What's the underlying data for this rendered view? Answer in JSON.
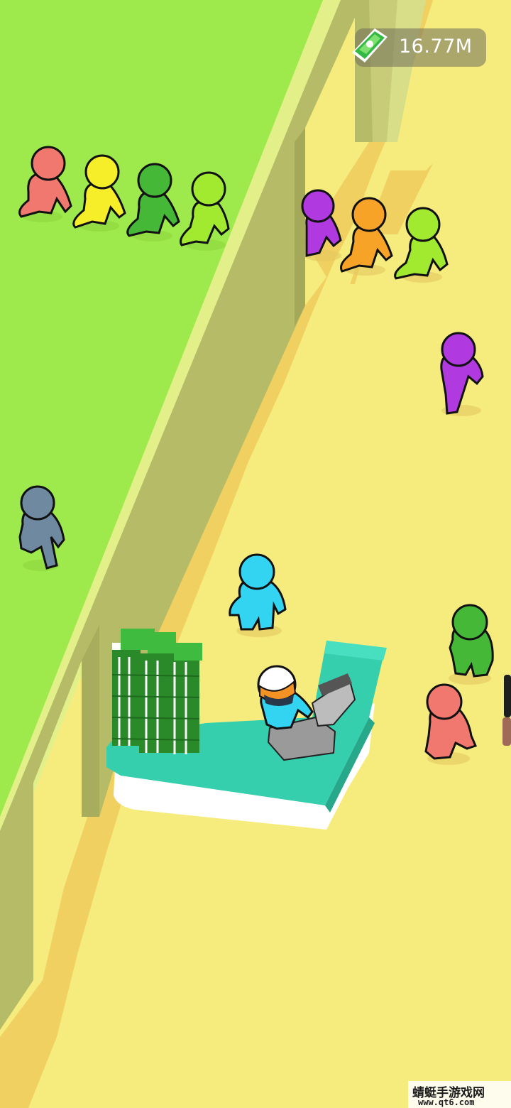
{
  "hud": {
    "money_value": "16.77M",
    "money_icon": "cash-stack-icon"
  },
  "colors": {
    "grass": "#9eea4d",
    "wall": "#b6bb67",
    "floor": "#f6ec7e",
    "path": "#f0d060",
    "counter": "#35cfae"
  },
  "watermark": {
    "title": "蜻蜓手游戏网",
    "url": "www.qt6.com"
  }
}
